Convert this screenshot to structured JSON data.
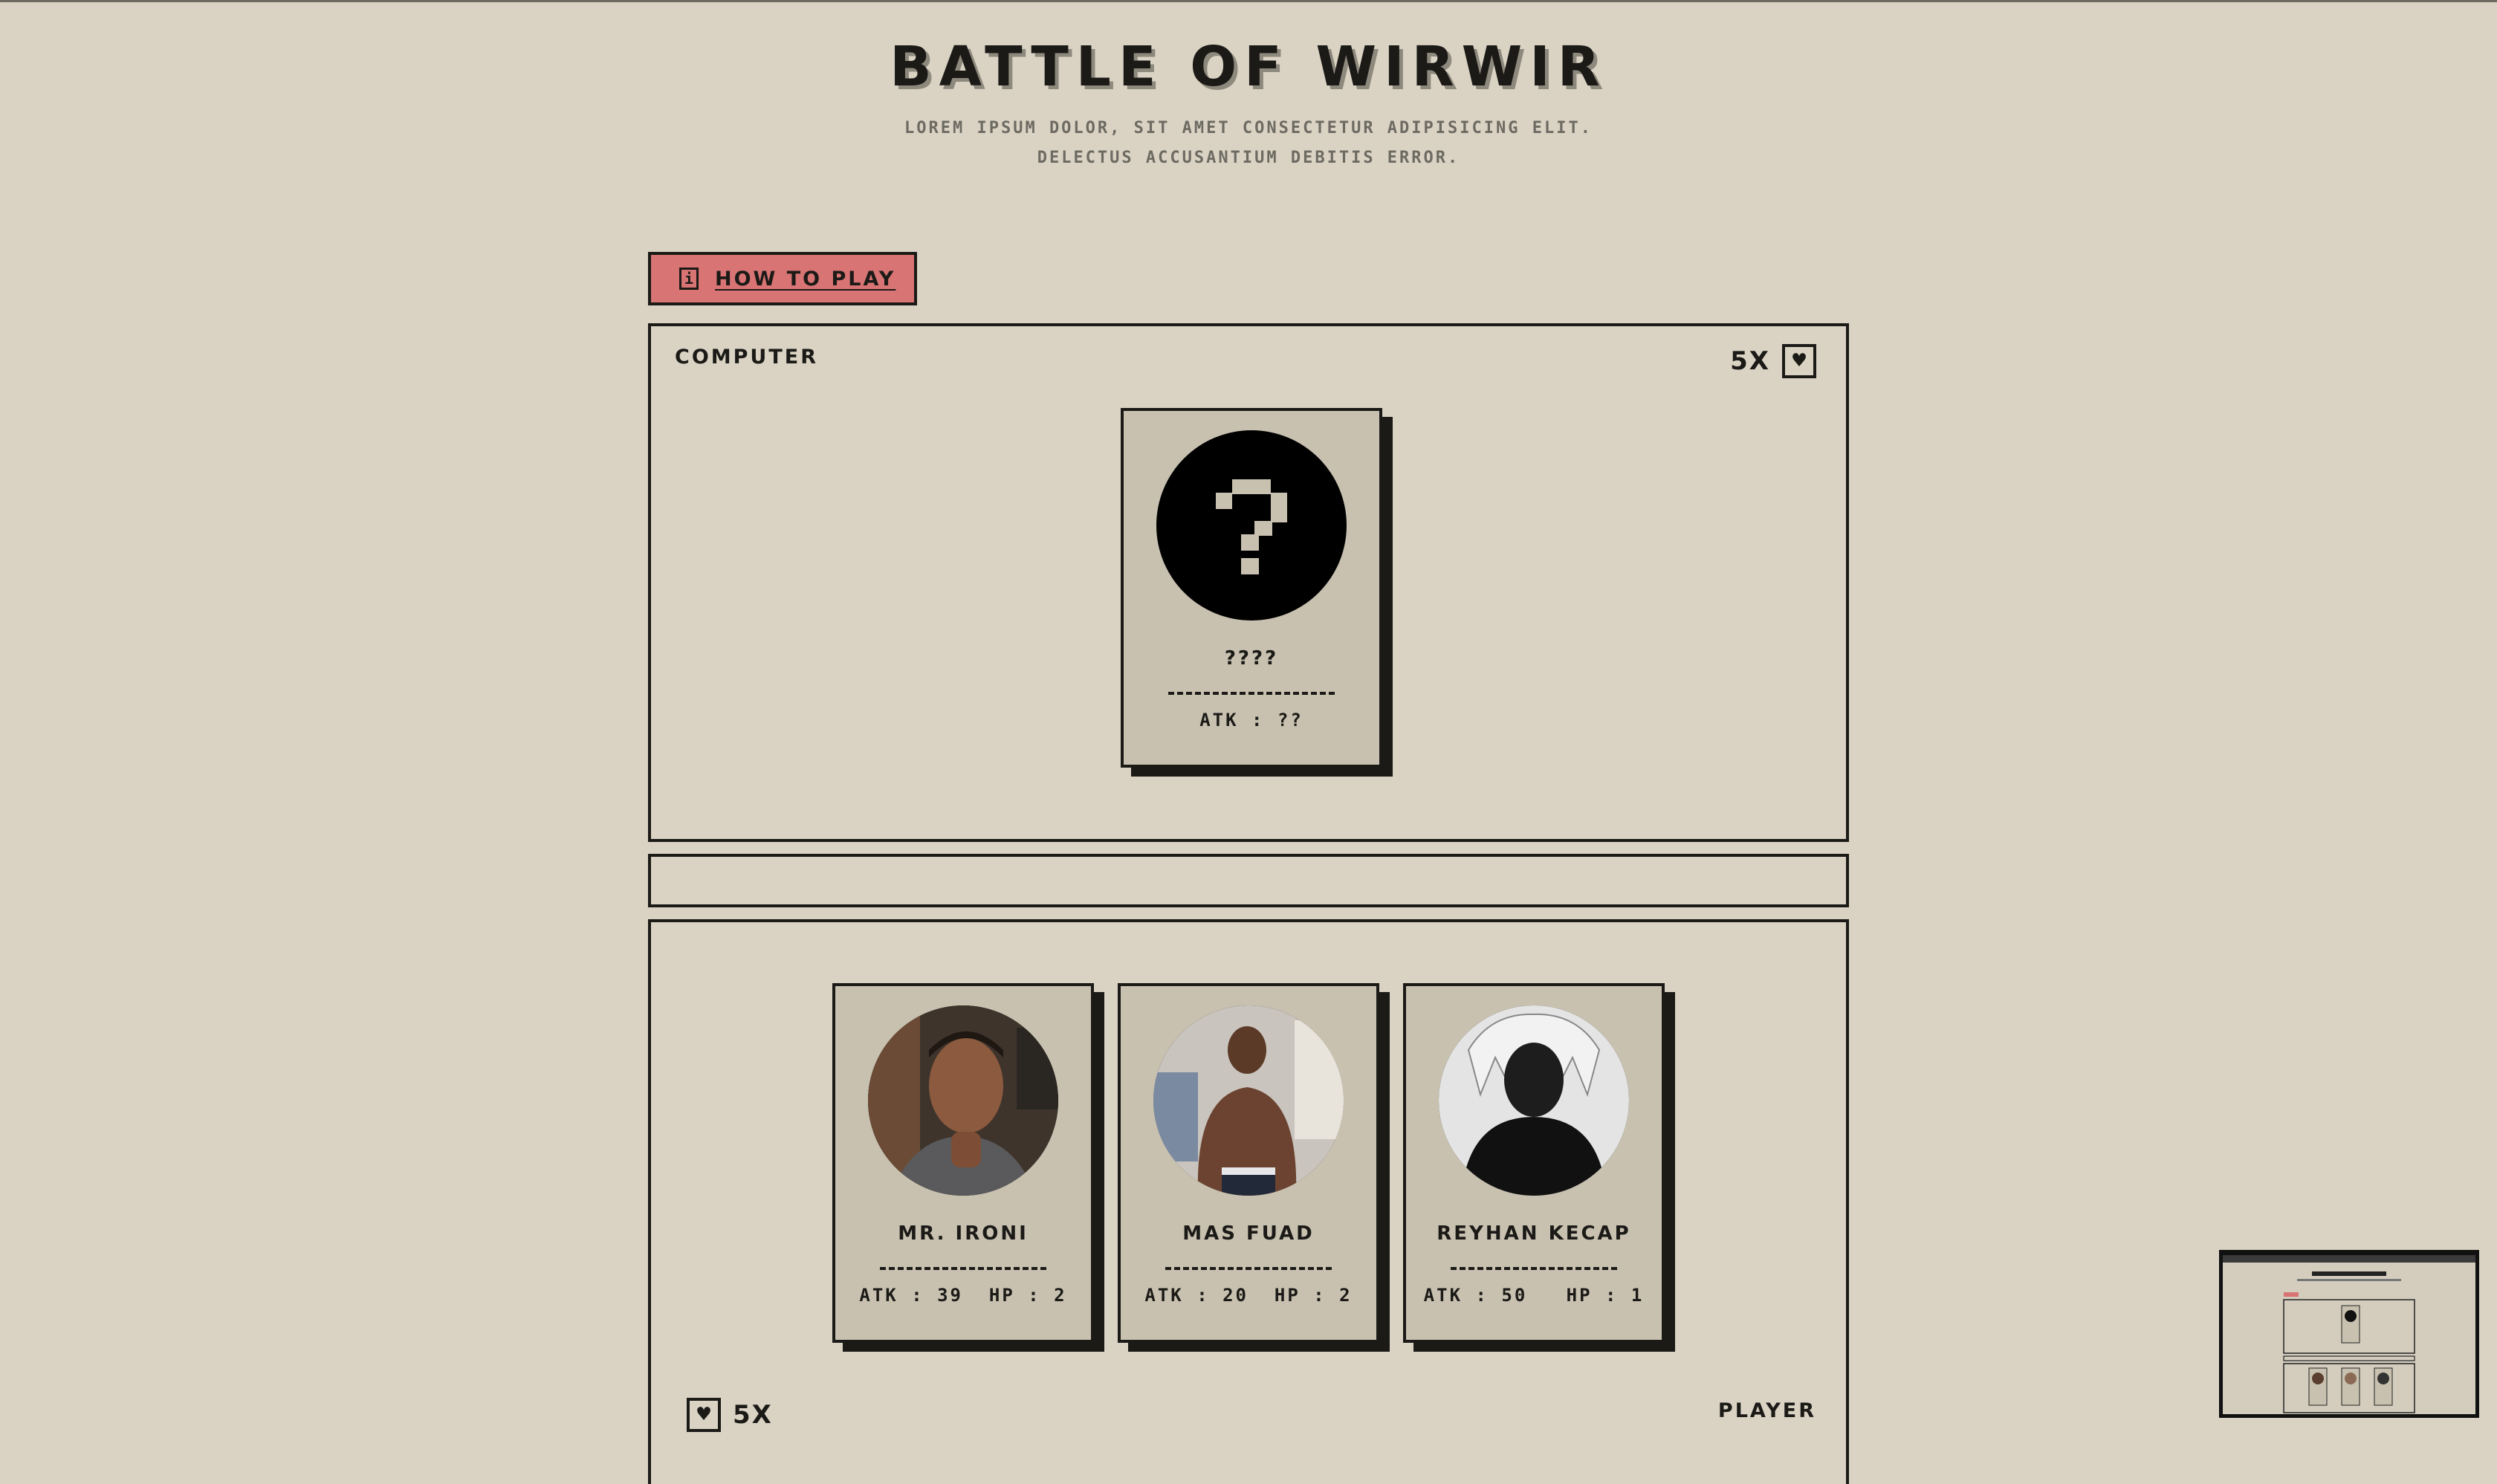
{
  "header": {
    "title": "BATTLE OF WIRWIR",
    "subtitle_line1": "LOREM IPSUM DOLOR, SIT AMET CONSECTETUR ADIPISICING ELIT.",
    "subtitle_line2": "DELECTUS ACCUSANTIUM DEBITIS ERROR."
  },
  "how_to_play": {
    "label": "HOW TO PLAY",
    "icon": "info-icon"
  },
  "computer": {
    "label": "COMPUTER",
    "lives": "5X",
    "lives_icon": "heart-icon",
    "card": {
      "name": "????",
      "stats": "ATK : ??",
      "avatar_icon": "question-mark-icon"
    }
  },
  "message": {
    "text": ""
  },
  "player": {
    "label": "PLAYER",
    "lives": "5X",
    "lives_icon": "heart-icon",
    "cards": [
      {
        "name": "MR. IRONI",
        "stats": "ATK : 39  HP : 2"
      },
      {
        "name": "MAS FUAD",
        "stats": "ATK : 20  HP : 2"
      },
      {
        "name": "REYHAN KECAP",
        "stats": "ATK : 50   HP : 1"
      }
    ]
  },
  "colors": {
    "background": "#dad3c4",
    "card": "#c8c1b0",
    "ink": "#1b1a17",
    "button": "#d87474"
  }
}
